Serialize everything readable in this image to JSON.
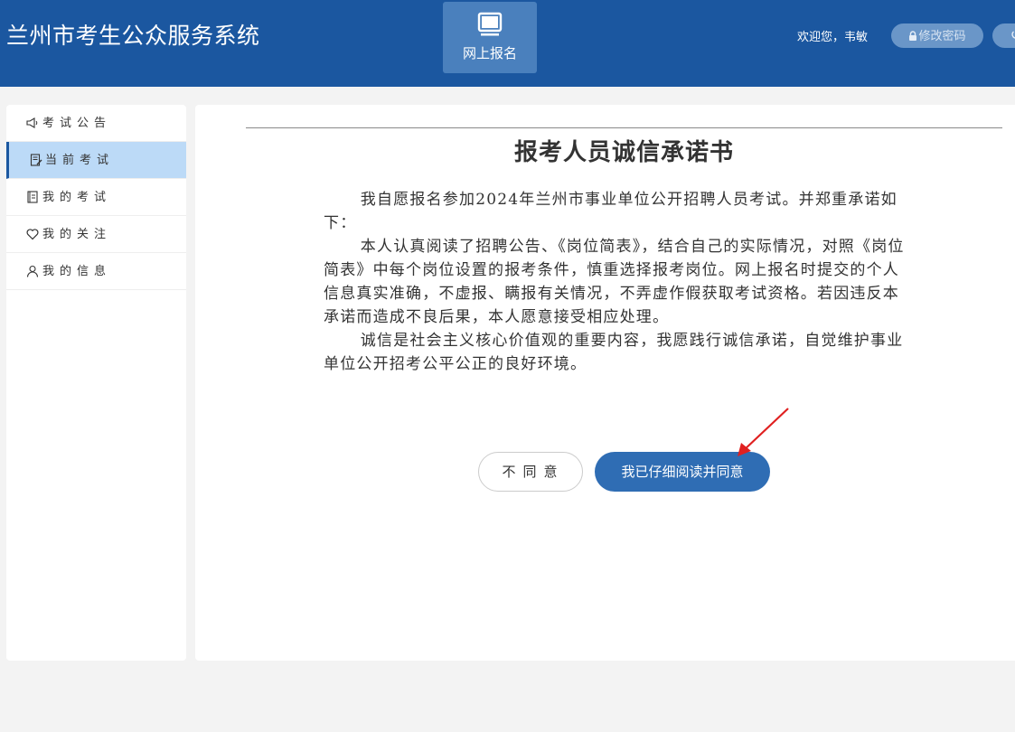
{
  "header": {
    "app_title": "兰州市考生公众服务系统",
    "nav_tile_label": "网上报名",
    "welcome_text": "欢迎您，韦敏",
    "change_password_label": "修改密码"
  },
  "sidebar": {
    "items": [
      {
        "label": "考试公告",
        "icon": "megaphone-icon"
      },
      {
        "label": "当前考试",
        "icon": "document-edit-icon",
        "active": true
      },
      {
        "label": "我的考试",
        "icon": "notebook-icon"
      },
      {
        "label": "我的关注",
        "icon": "heart-icon"
      },
      {
        "label": "我的信息",
        "icon": "user-icon"
      }
    ]
  },
  "document": {
    "title": "报考人员诚信承诺书",
    "paragraphs": [
      "我自愿报名参加2024年兰州市事业单位公开招聘人员考试。并郑重承诺如下：",
      "本人认真阅读了招聘公告、《岗位简表》，结合自己的实际情况，对照《岗位简表》中每个岗位设置的报考条件，慎重选择报考岗位。网上报名时提交的个人信息真实准确，不虚报、瞒报有关情况，不弄虚作假获取考试资格。若因违反本承诺而造成不良后果，本人愿意接受相应处理。",
      "诚信是社会主义核心价值观的重要内容，我愿践行诚信承诺，自觉维护事业单位公开招考公平公正的良好环境。"
    ]
  },
  "actions": {
    "disagree_label": "不同意",
    "agree_label": "我已仔细阅读并同意"
  },
  "colors": {
    "header_bg": "#1b57a0",
    "primary_button": "#2f6db4",
    "active_sidebar": "#bcdaf7",
    "annotation_arrow": "#e02020"
  }
}
